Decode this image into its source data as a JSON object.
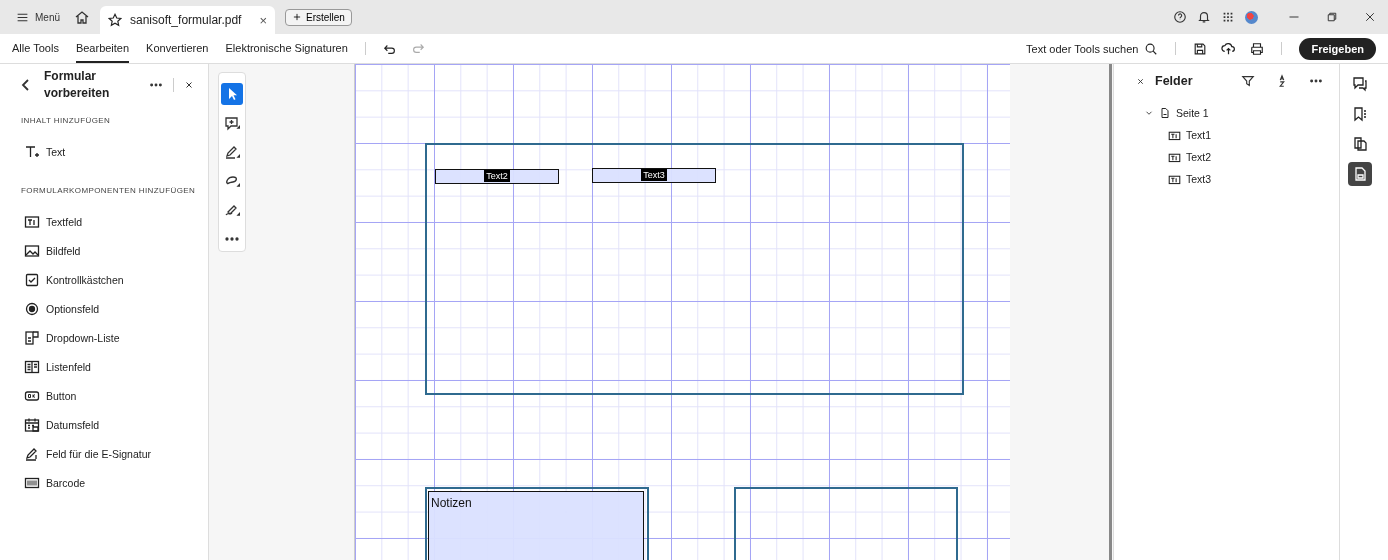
{
  "title_bar": {
    "menu": "Menü",
    "tab": {
      "title": "sanisoft_formular.pdf",
      "close": "×",
      "selected": true
    },
    "create_button": "Erstellen"
  },
  "toolbar": {
    "tabs": [
      {
        "label": "Alle Tools",
        "selected": false
      },
      {
        "label": "Bearbeiten",
        "selected": true
      },
      {
        "label": "Konvertieren",
        "selected": false
      },
      {
        "label": "Elektronische Signaturen",
        "selected": false
      }
    ],
    "search": "Text oder Tools suchen",
    "share_button": "Freigeben"
  },
  "left_panel": {
    "title": "Formular vorbereiten",
    "sections": [
      {
        "heading": "INHALT HINZUFÜGEN",
        "items": [
          {
            "kind": "text",
            "label": "Text"
          }
        ]
      },
      {
        "heading": "FORMULARKOMPONENTEN HINZUFÜGEN",
        "items": [
          {
            "kind": "textfield",
            "label": "Textfeld"
          },
          {
            "kind": "image",
            "label": "Bildfeld"
          },
          {
            "kind": "checkbox",
            "label": "Kontrollkästchen"
          },
          {
            "kind": "radio",
            "label": "Optionsfeld"
          },
          {
            "kind": "dropdown",
            "label": "Dropdown-Liste"
          },
          {
            "kind": "listbox",
            "label": "Listenfeld"
          },
          {
            "kind": "button",
            "label": "Button"
          },
          {
            "kind": "date",
            "label": "Datumsfeld"
          },
          {
            "kind": "signature",
            "label": "Feld für die E-Signatur"
          },
          {
            "kind": "barcode",
            "label": "Barcode"
          }
        ]
      }
    ]
  },
  "tool_rail": [
    {
      "kind": "select",
      "selected": true
    },
    {
      "kind": "comment",
      "selected": false
    },
    {
      "kind": "highlight",
      "selected": false
    },
    {
      "kind": "draw",
      "selected": false
    },
    {
      "kind": "sign",
      "selected": false
    },
    {
      "kind": "more",
      "selected": false
    }
  ],
  "document": {
    "fields": [
      {
        "kind": "text",
        "label": "Text2"
      },
      {
        "kind": "text",
        "label": "Text3"
      },
      {
        "kind": "area",
        "label": "Notizen"
      }
    ]
  },
  "fields_panel": {
    "title": "Felder",
    "tree": [
      {
        "label": "Seite 1",
        "expanded": true,
        "children": [
          {
            "label": "Text1"
          },
          {
            "label": "Text2"
          },
          {
            "label": "Text3"
          }
        ]
      }
    ]
  },
  "right_rail": [
    {
      "kind": "comments",
      "selected": false
    },
    {
      "kind": "bookmarks",
      "selected": false
    },
    {
      "kind": "pages",
      "selected": false
    },
    {
      "kind": "fields",
      "selected": true
    }
  ]
}
